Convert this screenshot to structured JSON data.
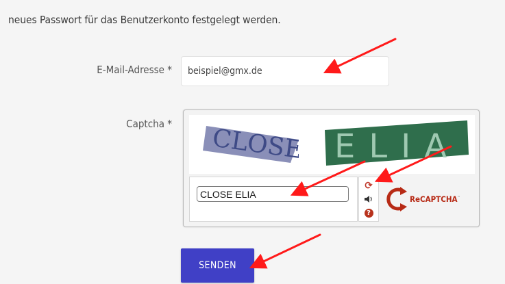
{
  "intro_text": "neues Passwort für das Benutzerkonto festgelegt werden.",
  "form": {
    "email_label": "E-Mail-Adresse *",
    "email_value": "beispiel@gmx.de",
    "captcha_label": "Captcha *",
    "submit_label": "SENDEN"
  },
  "recaptcha": {
    "challenge_word_1": "CLOSE",
    "challenge_word_2": "ELIA",
    "response_value": "CLOSE ELIA",
    "brand_prefix": "Re",
    "brand_name": "CAPTCHA",
    "brand_mark": "™",
    "icons": [
      "refresh-icon",
      "audio-icon",
      "help-icon"
    ],
    "brand_color": "#b72a15"
  },
  "colors": {
    "background": "#f5f5f5",
    "button": "#4040c6",
    "annotation_arrow": "#ff1a1a"
  }
}
